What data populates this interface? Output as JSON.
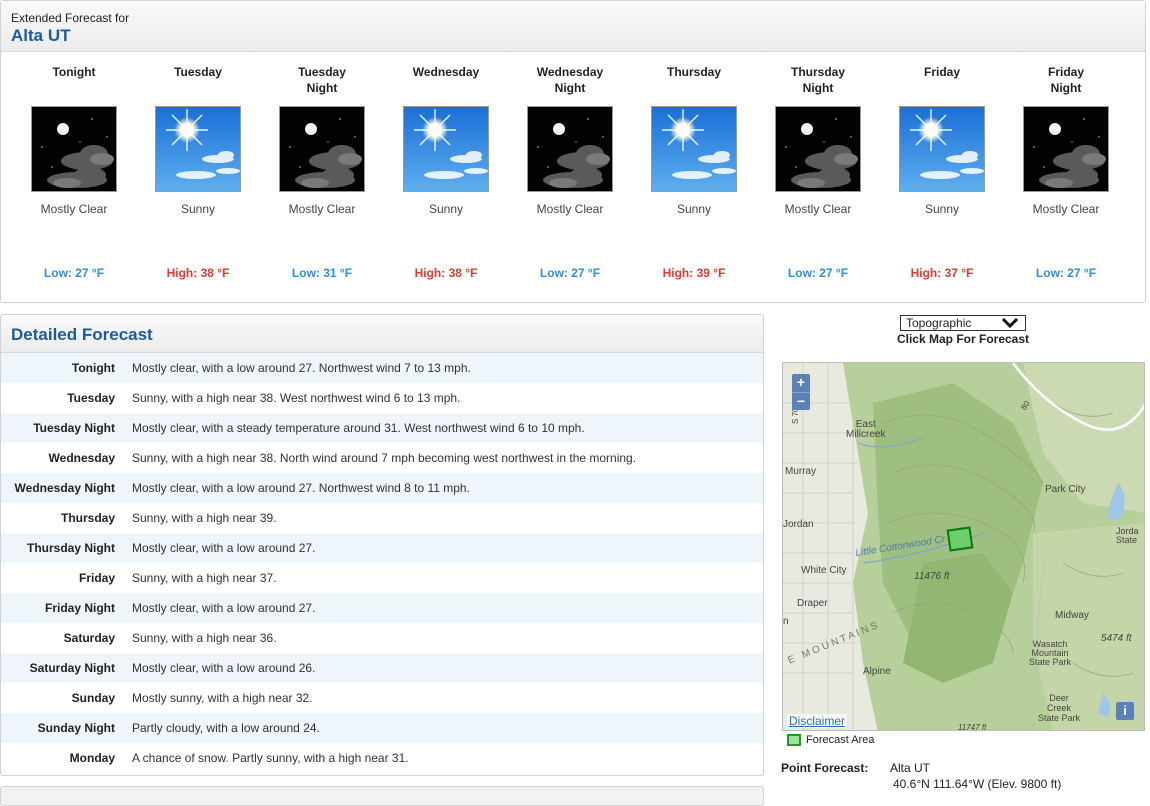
{
  "extended": {
    "subtitle": "Extended Forecast for",
    "location": "Alta UT",
    "periods": [
      {
        "name": "Tonight",
        "short": "Mostly Clear",
        "temp": "Low: 27 °F",
        "kind": "low",
        "icon": "night-mostly-clear-icon"
      },
      {
        "name": "Tuesday",
        "short": "Sunny",
        "temp": "High: 38 °F",
        "kind": "high",
        "icon": "sunny-icon"
      },
      {
        "name": "Tuesday\nNight",
        "short": "Mostly Clear",
        "temp": "Low: 31 °F",
        "kind": "low",
        "icon": "night-mostly-clear-icon"
      },
      {
        "name": "Wednesday",
        "short": "Sunny",
        "temp": "High: 38 °F",
        "kind": "high",
        "icon": "sunny-icon"
      },
      {
        "name": "Wednesday\nNight",
        "short": "Mostly Clear",
        "temp": "Low: 27 °F",
        "kind": "low",
        "icon": "night-mostly-clear-icon"
      },
      {
        "name": "Thursday",
        "short": "Sunny",
        "temp": "High: 39 °F",
        "kind": "high",
        "icon": "sunny-icon"
      },
      {
        "name": "Thursday\nNight",
        "short": "Mostly Clear",
        "temp": "Low: 27 °F",
        "kind": "low",
        "icon": "night-mostly-clear-icon"
      },
      {
        "name": "Friday",
        "short": "Sunny",
        "temp": "High: 37 °F",
        "kind": "high",
        "icon": "sunny-icon"
      },
      {
        "name": "Friday\nNight",
        "short": "Mostly Clear",
        "temp": "Low: 27 °F",
        "kind": "low",
        "icon": "night-mostly-clear-icon"
      }
    ]
  },
  "detailed": {
    "title": "Detailed Forecast",
    "rows": [
      {
        "label": "Tonight",
        "text": "Mostly clear, with a low around 27. Northwest wind 7 to 13 mph."
      },
      {
        "label": "Tuesday",
        "text": "Sunny, with a high near 38. West northwest wind 6 to 13 mph."
      },
      {
        "label": "Tuesday Night",
        "text": "Mostly clear, with a steady temperature around 31. West northwest wind 6 to 10 mph."
      },
      {
        "label": "Wednesday",
        "text": "Sunny, with a high near 38. North wind around 7 mph becoming west northwest in the morning."
      },
      {
        "label": "Wednesday Night",
        "text": "Mostly clear, with a low around 27. Northwest wind 8 to 11 mph."
      },
      {
        "label": "Thursday",
        "text": "Sunny, with a high near 39."
      },
      {
        "label": "Thursday Night",
        "text": "Mostly clear, with a low around 27."
      },
      {
        "label": "Friday",
        "text": "Sunny, with a high near 37."
      },
      {
        "label": "Friday Night",
        "text": "Mostly clear, with a low around 27."
      },
      {
        "label": "Saturday",
        "text": "Sunny, with a high near 36."
      },
      {
        "label": "Saturday Night",
        "text": "Mostly clear, with a low around 26."
      },
      {
        "label": "Sunday",
        "text": "Mostly sunny, with a high near 32."
      },
      {
        "label": "Sunday Night",
        "text": "Partly cloudy, with a low around 24."
      },
      {
        "label": "Monday",
        "text": "A chance of snow. Partly sunny, with a high near 31."
      }
    ]
  },
  "map": {
    "select_value": "Topographic",
    "caption": "Click Map For Forecast",
    "zoom_in": "+",
    "zoom_out": "−",
    "disclaimer": "Disclaimer",
    "info": "i",
    "legend": "Forecast Area",
    "labels": {
      "east_millcreek": "East\nMillcreek",
      "murray": "Murray",
      "park_city": "Park City",
      "jordan": "Jordan",
      "jordanelle": "Jorda\nState",
      "little_cottonwood": "Little Cottonwood Cr",
      "white_city": "White City",
      "elev_11476": "11476 ft",
      "draper": "Draper",
      "midway": "Midway",
      "elev_5474": "5474 ft",
      "wasatch_mountains": "E   M O U N T A I N S",
      "wasatch_mountain_sp": "Wasatch\nMountain\nState Park",
      "alpine": "Alpine",
      "deer_creek": "Deer\nCreek\nState Park",
      "route_80": "80",
      "route_s700": "S 700",
      "elev_11747": "11747 ft",
      "n_edge": "n"
    }
  },
  "point_forecast": {
    "label": "Point Forecast:",
    "name": "Alta UT",
    "coords": "40.6°N 111.64°W (Elev. 9800 ft)"
  },
  "colors": {
    "low_temp": "#2d8fd4",
    "high_temp": "#e2372e",
    "header_blue": "#1c5c9c",
    "row_stripe": "#eef5fb",
    "forecast_area": "#1b9e1b"
  }
}
